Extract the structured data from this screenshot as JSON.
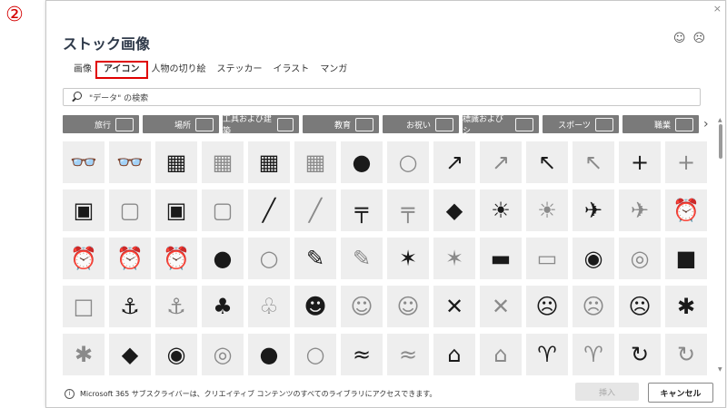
{
  "step_marker": "②",
  "dialog": {
    "title": "ストック画像",
    "close": "×",
    "smileys": [
      "☺",
      "☹"
    ]
  },
  "tabs": [
    {
      "label": "画像",
      "active": false
    },
    {
      "label": "アイコン",
      "active": true
    },
    {
      "label": "人物の切り絵",
      "active": false
    },
    {
      "label": "ステッカー",
      "active": false
    },
    {
      "label": "イラスト",
      "active": false
    },
    {
      "label": "マンガ",
      "active": false
    }
  ],
  "search": {
    "text": "\"データ\" の検索"
  },
  "categories": [
    {
      "label": "旅行"
    },
    {
      "label": "場所"
    },
    {
      "label": "工具および建築"
    },
    {
      "label": "教育"
    },
    {
      "label": "お祝い"
    },
    {
      "label": "標識およびシ"
    },
    {
      "label": "スポーツ"
    },
    {
      "label": "職業"
    }
  ],
  "category_next": "›",
  "icon_rows": [
    [
      {
        "g": "👓",
        "o": false
      },
      {
        "g": "👓",
        "o": true
      },
      {
        "g": "▦",
        "o": false
      },
      {
        "g": "▦",
        "o": true
      },
      {
        "g": "▦",
        "o": false
      },
      {
        "g": "▦",
        "o": true
      },
      {
        "g": "●",
        "o": false
      },
      {
        "g": "○",
        "o": true
      },
      {
        "g": "↗",
        "o": false
      },
      {
        "g": "↗",
        "o": true
      },
      {
        "g": "↖",
        "o": false
      },
      {
        "g": "↖",
        "o": true
      },
      {
        "g": "+",
        "o": false
      },
      {
        "g": "+",
        "o": true
      }
    ],
    [
      {
        "g": "▣",
        "o": false
      },
      {
        "g": "▢",
        "o": true
      },
      {
        "g": "▣",
        "o": false
      },
      {
        "g": "▢",
        "o": true
      },
      {
        "g": "╱",
        "o": false
      },
      {
        "g": "╱",
        "o": true
      },
      {
        "g": "╤",
        "o": false
      },
      {
        "g": "╤",
        "o": true
      },
      {
        "g": "◆",
        "o": false
      },
      {
        "g": "☀",
        "o": false
      },
      {
        "g": "☀",
        "o": true
      },
      {
        "g": "✈",
        "o": false
      },
      {
        "g": "✈",
        "o": true
      },
      {
        "g": "⏰",
        "o": false
      }
    ],
    [
      {
        "g": "⏰",
        "o": true
      },
      {
        "g": "⏰",
        "o": false
      },
      {
        "g": "⏰",
        "o": true
      },
      {
        "g": "●",
        "o": false
      },
      {
        "g": "○",
        "o": true
      },
      {
        "g": "✎",
        "o": false
      },
      {
        "g": "✎",
        "o": true
      },
      {
        "g": "✶",
        "o": false
      },
      {
        "g": "✶",
        "o": true
      },
      {
        "g": "▬",
        "o": false
      },
      {
        "g": "▭",
        "o": true
      },
      {
        "g": "◉",
        "o": false
      },
      {
        "g": "◎",
        "o": true
      },
      {
        "g": "■",
        "o": false
      }
    ],
    [
      {
        "g": "□",
        "o": true
      },
      {
        "g": "⚓",
        "o": false
      },
      {
        "g": "⚓",
        "o": true
      },
      {
        "g": "♣",
        "o": false
      },
      {
        "g": "♧",
        "o": true
      },
      {
        "g": "☻",
        "o": false
      },
      {
        "g": "☺",
        "o": true
      },
      {
        "g": "☺",
        "o": true
      },
      {
        "g": "✕",
        "o": false
      },
      {
        "g": "✕",
        "o": true
      },
      {
        "g": "☹",
        "o": false
      },
      {
        "g": "☹",
        "o": true
      },
      {
        "g": "☹",
        "o": false
      },
      {
        "g": "✱",
        "o": false
      }
    ],
    [
      {
        "g": "✱",
        "o": true
      },
      {
        "g": "◆",
        "o": false
      },
      {
        "g": "◉",
        "o": false
      },
      {
        "g": "◎",
        "o": true
      },
      {
        "g": "●",
        "o": false
      },
      {
        "g": "○",
        "o": true
      },
      {
        "g": "≈",
        "o": false
      },
      {
        "g": "≈",
        "o": true
      },
      {
        "g": "⌂",
        "o": false
      },
      {
        "g": "⌂",
        "o": true
      },
      {
        "g": "♈",
        "o": false
      },
      {
        "g": "♈",
        "o": true
      },
      {
        "g": "↻",
        "o": false
      },
      {
        "g": "↻",
        "o": true
      }
    ]
  ],
  "footer": {
    "info_icon": "i",
    "note": "Microsoft 365 サブスクライバーは、クリエイティブ コンテンツのすべてのライブラリにアクセスできます。",
    "insert_label": "挿入",
    "cancel_label": "キャンセル"
  }
}
